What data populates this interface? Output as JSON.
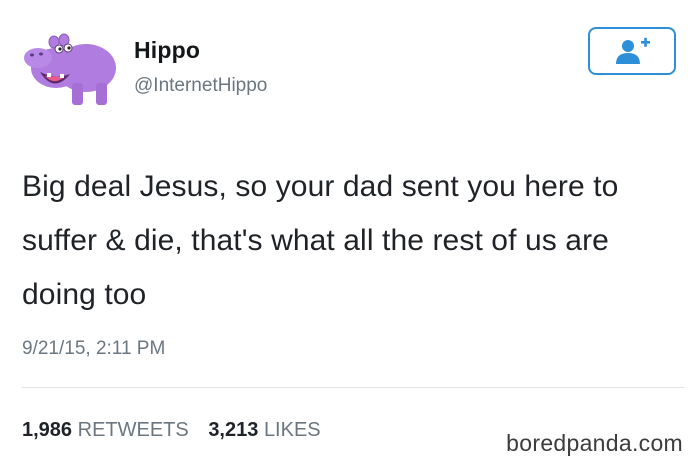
{
  "user": {
    "name": "Hippo",
    "handle": "@InternetHippo",
    "avatar_icon": "purple-hippo-avatar",
    "avatar_color": "#b07ce0"
  },
  "follow_button": {
    "icon": "add-user-icon",
    "color": "#2d8fd8"
  },
  "tweet": {
    "text": "Big deal Jesus, so your dad sent you here to suffer & die, that's what all the rest of us are doing too",
    "timestamp": "9/21/15, 2:11 PM"
  },
  "stats": {
    "retweets_count": "1,986",
    "retweets_label": "RETWEETS",
    "likes_count": "3,213",
    "likes_label": "LIKES"
  },
  "watermark": "boredpanda.com"
}
